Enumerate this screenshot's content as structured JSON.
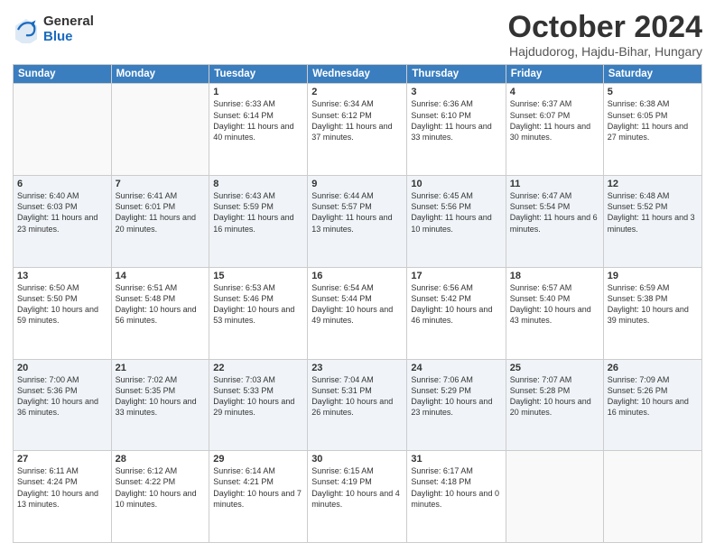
{
  "logo": {
    "general": "General",
    "blue": "Blue"
  },
  "header": {
    "title": "October 2024",
    "subtitle": "Hajdudorog, Hajdu-Bihar, Hungary"
  },
  "columns": [
    "Sunday",
    "Monday",
    "Tuesday",
    "Wednesday",
    "Thursday",
    "Friday",
    "Saturday"
  ],
  "weeks": [
    [
      {
        "day": "",
        "info": ""
      },
      {
        "day": "",
        "info": ""
      },
      {
        "day": "1",
        "info": "Sunrise: 6:33 AM\nSunset: 6:14 PM\nDaylight: 11 hours and 40 minutes."
      },
      {
        "day": "2",
        "info": "Sunrise: 6:34 AM\nSunset: 6:12 PM\nDaylight: 11 hours and 37 minutes."
      },
      {
        "day": "3",
        "info": "Sunrise: 6:36 AM\nSunset: 6:10 PM\nDaylight: 11 hours and 33 minutes."
      },
      {
        "day": "4",
        "info": "Sunrise: 6:37 AM\nSunset: 6:07 PM\nDaylight: 11 hours and 30 minutes."
      },
      {
        "day": "5",
        "info": "Sunrise: 6:38 AM\nSunset: 6:05 PM\nDaylight: 11 hours and 27 minutes."
      }
    ],
    [
      {
        "day": "6",
        "info": "Sunrise: 6:40 AM\nSunset: 6:03 PM\nDaylight: 11 hours and 23 minutes."
      },
      {
        "day": "7",
        "info": "Sunrise: 6:41 AM\nSunset: 6:01 PM\nDaylight: 11 hours and 20 minutes."
      },
      {
        "day": "8",
        "info": "Sunrise: 6:43 AM\nSunset: 5:59 PM\nDaylight: 11 hours and 16 minutes."
      },
      {
        "day": "9",
        "info": "Sunrise: 6:44 AM\nSunset: 5:57 PM\nDaylight: 11 hours and 13 minutes."
      },
      {
        "day": "10",
        "info": "Sunrise: 6:45 AM\nSunset: 5:56 PM\nDaylight: 11 hours and 10 minutes."
      },
      {
        "day": "11",
        "info": "Sunrise: 6:47 AM\nSunset: 5:54 PM\nDaylight: 11 hours and 6 minutes."
      },
      {
        "day": "12",
        "info": "Sunrise: 6:48 AM\nSunset: 5:52 PM\nDaylight: 11 hours and 3 minutes."
      }
    ],
    [
      {
        "day": "13",
        "info": "Sunrise: 6:50 AM\nSunset: 5:50 PM\nDaylight: 10 hours and 59 minutes."
      },
      {
        "day": "14",
        "info": "Sunrise: 6:51 AM\nSunset: 5:48 PM\nDaylight: 10 hours and 56 minutes."
      },
      {
        "day": "15",
        "info": "Sunrise: 6:53 AM\nSunset: 5:46 PM\nDaylight: 10 hours and 53 minutes."
      },
      {
        "day": "16",
        "info": "Sunrise: 6:54 AM\nSunset: 5:44 PM\nDaylight: 10 hours and 49 minutes."
      },
      {
        "day": "17",
        "info": "Sunrise: 6:56 AM\nSunset: 5:42 PM\nDaylight: 10 hours and 46 minutes."
      },
      {
        "day": "18",
        "info": "Sunrise: 6:57 AM\nSunset: 5:40 PM\nDaylight: 10 hours and 43 minutes."
      },
      {
        "day": "19",
        "info": "Sunrise: 6:59 AM\nSunset: 5:38 PM\nDaylight: 10 hours and 39 minutes."
      }
    ],
    [
      {
        "day": "20",
        "info": "Sunrise: 7:00 AM\nSunset: 5:36 PM\nDaylight: 10 hours and 36 minutes."
      },
      {
        "day": "21",
        "info": "Sunrise: 7:02 AM\nSunset: 5:35 PM\nDaylight: 10 hours and 33 minutes."
      },
      {
        "day": "22",
        "info": "Sunrise: 7:03 AM\nSunset: 5:33 PM\nDaylight: 10 hours and 29 minutes."
      },
      {
        "day": "23",
        "info": "Sunrise: 7:04 AM\nSunset: 5:31 PM\nDaylight: 10 hours and 26 minutes."
      },
      {
        "day": "24",
        "info": "Sunrise: 7:06 AM\nSunset: 5:29 PM\nDaylight: 10 hours and 23 minutes."
      },
      {
        "day": "25",
        "info": "Sunrise: 7:07 AM\nSunset: 5:28 PM\nDaylight: 10 hours and 20 minutes."
      },
      {
        "day": "26",
        "info": "Sunrise: 7:09 AM\nSunset: 5:26 PM\nDaylight: 10 hours and 16 minutes."
      }
    ],
    [
      {
        "day": "27",
        "info": "Sunrise: 6:11 AM\nSunset: 4:24 PM\nDaylight: 10 hours and 13 minutes."
      },
      {
        "day": "28",
        "info": "Sunrise: 6:12 AM\nSunset: 4:22 PM\nDaylight: 10 hours and 10 minutes."
      },
      {
        "day": "29",
        "info": "Sunrise: 6:14 AM\nSunset: 4:21 PM\nDaylight: 10 hours and 7 minutes."
      },
      {
        "day": "30",
        "info": "Sunrise: 6:15 AM\nSunset: 4:19 PM\nDaylight: 10 hours and 4 minutes."
      },
      {
        "day": "31",
        "info": "Sunrise: 6:17 AM\nSunset: 4:18 PM\nDaylight: 10 hours and 0 minutes."
      },
      {
        "day": "",
        "info": ""
      },
      {
        "day": "",
        "info": ""
      }
    ]
  ]
}
